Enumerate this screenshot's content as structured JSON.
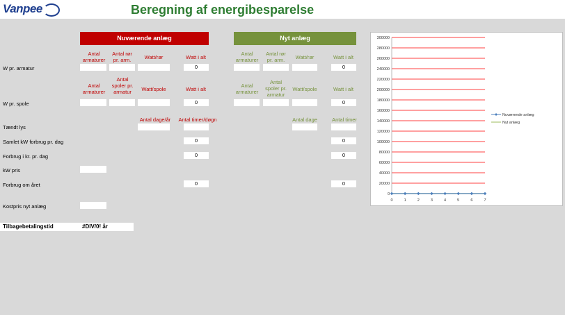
{
  "header": {
    "logo_text": "Vanpee",
    "title": "Beregning af energibesparelse"
  },
  "current": {
    "band_label": "Nuværende anlæg",
    "armatur_cols": [
      "Antal armaturer",
      "Antal rør pr. arm.",
      "Watt/rør",
      "Watt i alt"
    ],
    "spole_cols": [
      "Antal armaturer",
      "Antal spoler pr. armatur",
      "Watt/spole",
      "Watt i alt"
    ],
    "dage_cols": [
      "Antal dage/år",
      "Antal timer/døgn"
    ],
    "w_arm_total": "0",
    "w_spole_total": "0",
    "kw_day": "0",
    "kr_day": "0",
    "year": "0"
  },
  "new": {
    "band_label": "Nyt anlæg",
    "armatur_cols": [
      "Antal armaturer",
      "Antal rør pr. arm.",
      "Watt/rør",
      "Watt i alt"
    ],
    "spole_cols": [
      "Antal armaturer",
      "Antal spoler pr. armatur",
      "Watt/spole",
      "Watt i alt"
    ],
    "dage_cols": [
      "Antal dage",
      "Antal timer"
    ],
    "w_arm_total": "0",
    "w_spole_total": "0",
    "kw_day": "0",
    "kr_day": "0",
    "year": "0"
  },
  "rows": {
    "w_arm": "W pr. armatur",
    "w_spole": "W pr.  spole",
    "taendt": "Tændt lys",
    "kw_day": "Samlet kW forbrug pr. dag",
    "kr_day": "Forbrug i kr. pr. dag",
    "kw_price": "kW pris",
    "year": "Forbrug om året",
    "cost_new": "Kostpris nyt anlæg",
    "payback": "Tilbagebetalingstid",
    "payback_value": "#DIV/0! år"
  },
  "chart_data": {
    "type": "line",
    "x": [
      0,
      1,
      2,
      3,
      4,
      5,
      6,
      7
    ],
    "series": [
      {
        "name": "Nuværende anlæg",
        "values": [
          0,
          0,
          0,
          0,
          0,
          0,
          0,
          0
        ],
        "color": "#4f81bd"
      },
      {
        "name": "Nyt anlæg",
        "values": [
          0,
          0,
          0,
          0,
          0,
          0,
          0,
          0
        ],
        "color": "#9bbb59"
      }
    ],
    "ylim": [
      0,
      300000
    ],
    "yticks": [
      "0",
      "20000",
      "40000",
      "60000",
      "80000",
      "100000",
      "120000",
      "140000",
      "160000",
      "180000",
      "200000",
      "220000",
      "240000",
      "260000",
      "280000",
      "300000"
    ],
    "grid": true,
    "grid_color": "#ff0000",
    "legend": "right"
  }
}
